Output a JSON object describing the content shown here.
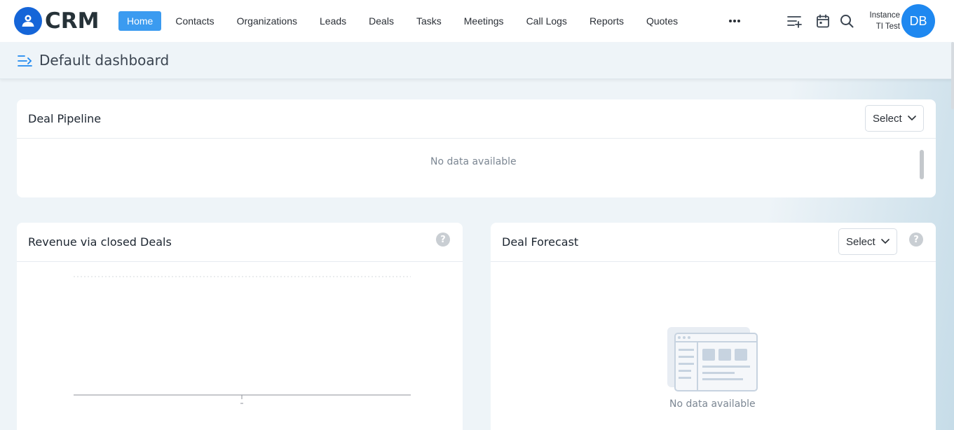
{
  "app": {
    "logo_text": "CRM"
  },
  "nav": {
    "items": [
      "Home",
      "Contacts",
      "Organizations",
      "Leads",
      "Deals",
      "Tasks",
      "Meetings",
      "Call Logs",
      "Reports",
      "Quotes"
    ],
    "active": "Home",
    "more_icon": "more-horizontal-icon"
  },
  "header_icons": [
    "add-list-icon",
    "calendar-icon",
    "search-icon"
  ],
  "user": {
    "instance_line1": "Instance",
    "instance_line2": "TI Test",
    "initials": "DB"
  },
  "page": {
    "title": "Default dashboard",
    "toggle_icon": "sidebar-toggle-icon"
  },
  "cards": {
    "pipeline": {
      "title": "Deal Pipeline",
      "select_label": "Select",
      "empty_text": "No data available"
    },
    "revenue": {
      "title": "Revenue via closed Deals",
      "help": "?"
    },
    "forecast": {
      "title": "Deal Forecast",
      "select_label": "Select",
      "help": "?",
      "empty_text": "No data available"
    }
  },
  "colors": {
    "accent": "#3b9bf0",
    "brand": "#1565d8",
    "avatar": "#1e88f0",
    "background": "#eef4f8"
  }
}
